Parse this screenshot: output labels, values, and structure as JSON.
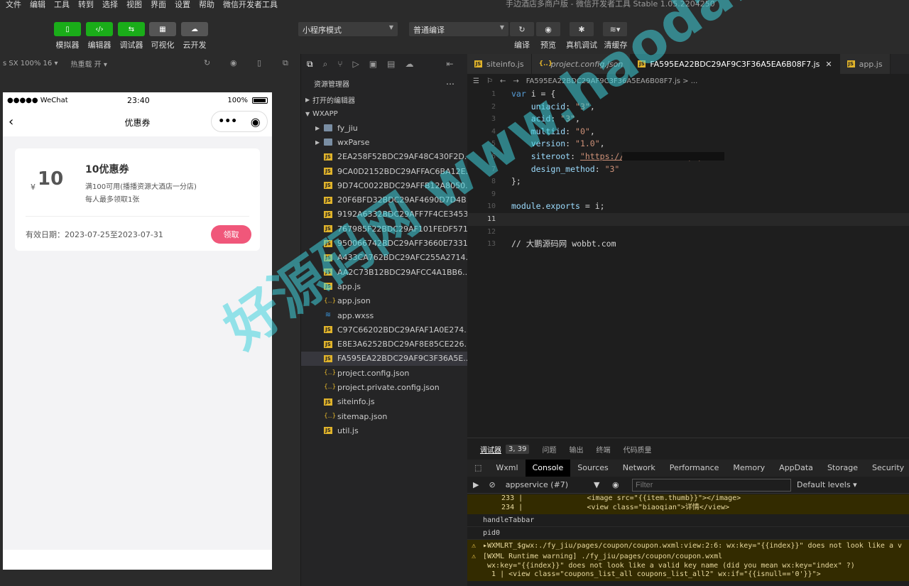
{
  "menubar": {
    "items": [
      "文件",
      "编辑",
      "工具",
      "转到",
      "选择",
      "视图",
      "界面",
      "设置",
      "帮助",
      "微信开发者工具"
    ],
    "window_title": "手边酒店多商户版 - 微信开发者工具 Stable 1.05.2204250"
  },
  "toolbar": {
    "simulator_label": "模拟器",
    "editor_label": "编辑器",
    "debugger_label": "调试器",
    "visual_label": "可视化",
    "cloud_label": "云开发",
    "mode_select": "小程序模式",
    "compile_select": "普通编译",
    "compile_label": "编译",
    "preview_label": "预览",
    "realdebug_label": "真机调试",
    "clearcache_label": "清缓存"
  },
  "simulator": {
    "device": "s SX 100% 16",
    "hotreload": "热重载 开",
    "statusbar": {
      "carrier": "●●●●● WeChat",
      "time": "23:40",
      "battery": "100%"
    },
    "nav_title": "优惠券",
    "coupon": {
      "yen": "¥",
      "amount": "10",
      "name": "10优惠券",
      "desc": "满100可用(播播资源大酒店一分店)",
      "limit": "每人最多领取1张",
      "valid": "有效日期：2023-07-25至2023-07-31",
      "button": "领取"
    }
  },
  "explorer": {
    "title": "资源管理器",
    "open_editors": "打开的编辑器",
    "root": "WXAPP",
    "files": [
      {
        "name": "fy_jiu",
        "type": "folder"
      },
      {
        "name": "wxParse",
        "type": "folder"
      },
      {
        "name": "2EA258F52BDC29AF48C430F2D...",
        "type": "js"
      },
      {
        "name": "9CA0D2152BDC29AFFAC6BA12E...",
        "type": "js"
      },
      {
        "name": "9D74C0022BDC29AFFB12A8050...",
        "type": "js"
      },
      {
        "name": "20F6BFD32BDC29AF4690D7D4B...",
        "type": "js"
      },
      {
        "name": "9192A6332BDC29AFF7F4CE3453...",
        "type": "js"
      },
      {
        "name": "767985F22BDC29AF101FEDF571...",
        "type": "js"
      },
      {
        "name": "950066742BDC29AFF3660E7331...",
        "type": "js"
      },
      {
        "name": "A433CA762BDC29AFC255A2714...",
        "type": "js"
      },
      {
        "name": "AA2C73B12BDC29AFCC4A1BB6...",
        "type": "js"
      },
      {
        "name": "app.js",
        "type": "js"
      },
      {
        "name": "app.json",
        "type": "json"
      },
      {
        "name": "app.wxss",
        "type": "wxss"
      },
      {
        "name": "C97C66202BDC29AFAF1A0E274...",
        "type": "js"
      },
      {
        "name": "E8E3A6252BDC29AF8E85CE226...",
        "type": "js"
      },
      {
        "name": "FA595EA22BDC29AF9C3F36A5E...",
        "type": "js"
      },
      {
        "name": "project.config.json",
        "type": "json"
      },
      {
        "name": "project.private.config.json",
        "type": "json"
      },
      {
        "name": "siteinfo.js",
        "type": "js"
      },
      {
        "name": "sitemap.json",
        "type": "json"
      },
      {
        "name": "util.js",
        "type": "js"
      }
    ],
    "selected_index": 16
  },
  "editor": {
    "tabs": [
      {
        "name": "siteinfo.js",
        "type": "js"
      },
      {
        "name": "project.config.json",
        "type": "json"
      },
      {
        "name": "FA595EA22BDC29AF9C3F36A5EA6B08F7.js",
        "type": "js",
        "active": true
      },
      {
        "name": "app.js",
        "type": "js"
      }
    ],
    "breadcrumb": "FA595EA22BDC29AF9C3F36A5EA6B08F7.js > ...",
    "lines": [
      {
        "n": "1",
        "text": "var i = {"
      },
      {
        "n": "2",
        "text": "uniacid: \"3\","
      },
      {
        "n": "3",
        "text": "acid: \"3\","
      },
      {
        "n": "4",
        "text": "multiid: \"0\","
      },
      {
        "n": "5",
        "text": "version: \"1.0\","
      },
      {
        "n": "6",
        "text": "siteroot: \"https://dem.../index.php\","
      },
      {
        "n": "7",
        "text": "design_method: \"3\""
      },
      {
        "n": "8",
        "text": "};"
      },
      {
        "n": "9",
        "text": ""
      },
      {
        "n": "10",
        "text": "module.exports = i;"
      },
      {
        "n": "11",
        "text": ""
      },
      {
        "n": "12",
        "text": ""
      },
      {
        "n": "13",
        "text": "// 大鹏源码网 wobbt.com"
      }
    ]
  },
  "debugger": {
    "tabs": [
      "调试器",
      "问题",
      "输出",
      "终端",
      "代码质量"
    ],
    "badge": "3, 39",
    "panels": [
      "Wxml",
      "Console",
      "Sources",
      "Network",
      "Performance",
      "Memory",
      "AppData",
      "Storage",
      "Security"
    ],
    "active_panel": "Console",
    "context": "appservice (#7)",
    "filter_placeholder": "Filter",
    "levels": "Default levels",
    "logs": [
      {
        "type": "warn",
        "text": "  233 |               <image src=\"{{item.thumb}}\"></image>\n  234 |               <view class=\"biaoqian\">详情</view>"
      },
      {
        "type": "plain",
        "text": "handleTabbar"
      },
      {
        "type": "plain",
        "text": "pid0"
      },
      {
        "type": "warn",
        "text": "▸WXMLRT_$gwx:./fy_jiu/pages/coupon/coupon.wxml:view:2:6: wx:key=\"{{index}}\" does not look like a v"
      },
      {
        "type": "warn",
        "text": "[WXML Runtime warning] ./fy_jiu/pages/coupon/coupon.wxml\n wx:key=\"{{index}}\" does not look like a valid key name (did you mean wx:key=\"index\" ?)\n  1 | <view class=\"coupons_list_all coupons_list_all2\" wx:if=\"{{isnull=='0'}}\">"
      }
    ]
  },
  "watermark": {
    "main": "好源码网 www.haodaima.cc"
  }
}
